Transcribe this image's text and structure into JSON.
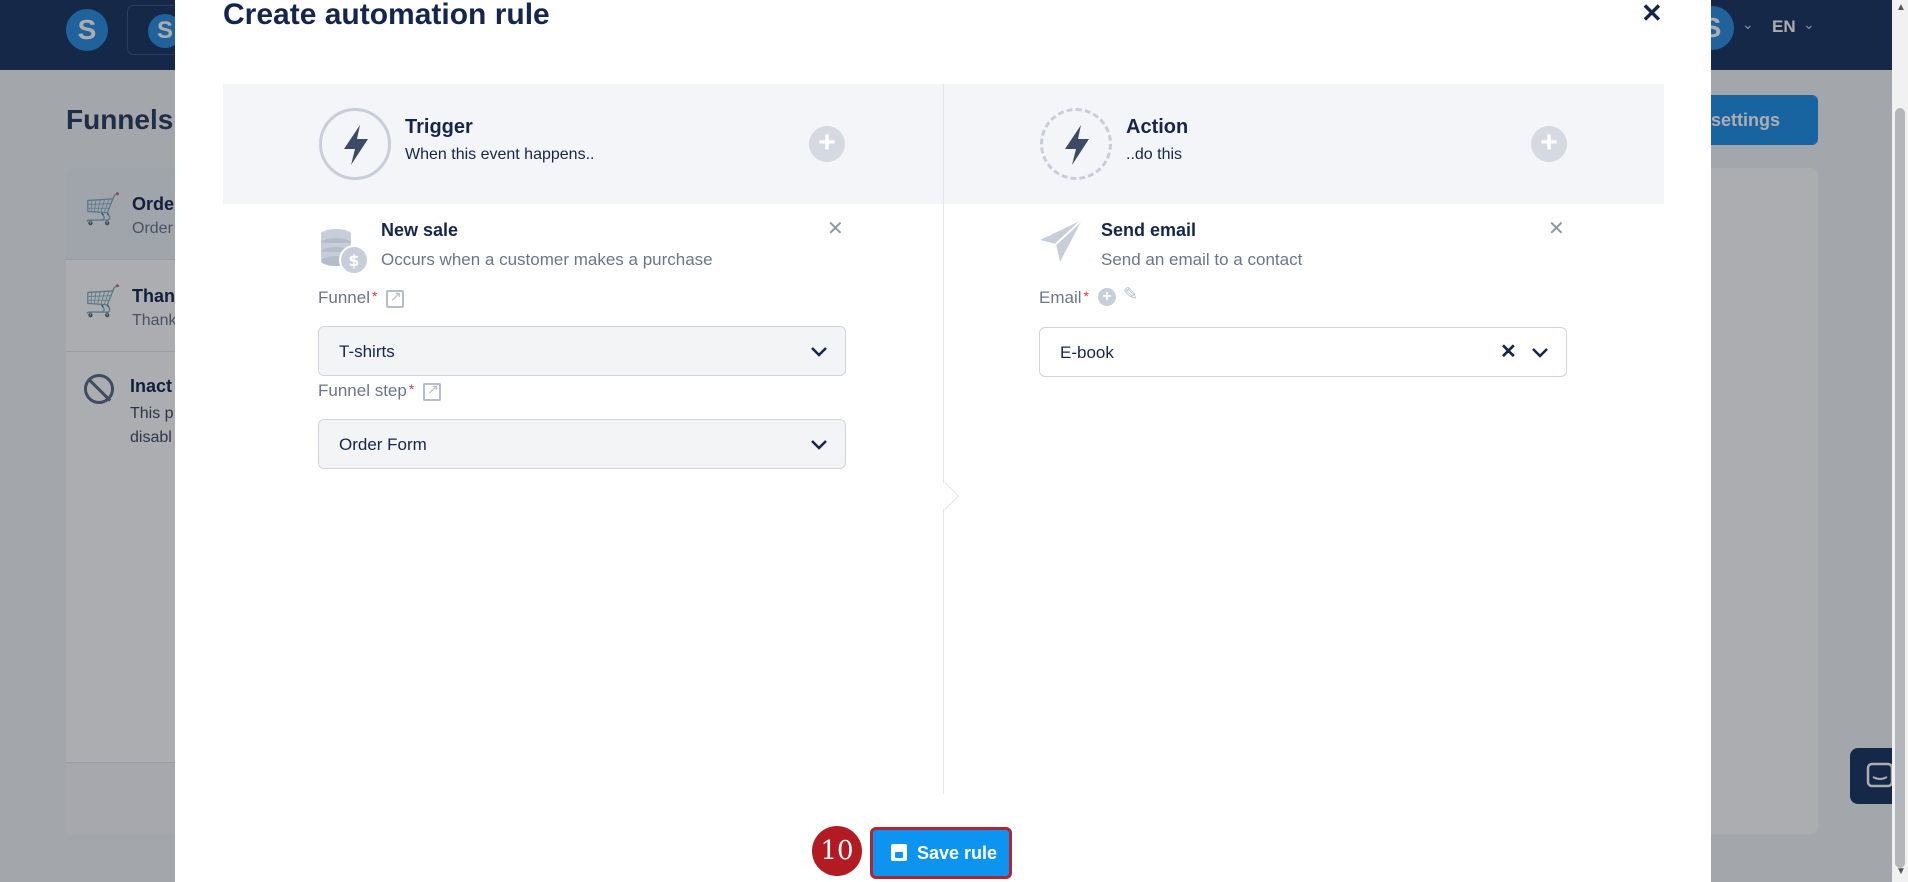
{
  "background": {
    "language": "EN",
    "page_title": "Funnels",
    "settings_button": "nel settings",
    "steps": [
      {
        "name": "Orde",
        "sub": "Order"
      },
      {
        "name": "Than",
        "sub": "Thank"
      }
    ],
    "inactive": {
      "title": "Inact",
      "text": "This p\ndisabl"
    }
  },
  "modal": {
    "title": "Create automation rule",
    "close_icon": "close-icon",
    "trigger": {
      "title": "Trigger",
      "subtitle": "When this event happens..",
      "card": {
        "title": "New sale",
        "subtitle": "Occurs when a customer makes a purchase"
      },
      "funnel_label": "Funnel",
      "funnel_value": "T-shirts",
      "step_label": "Funnel step",
      "step_value": "Order Form"
    },
    "action": {
      "title": "Action",
      "subtitle": "..do this",
      "card": {
        "title": "Send email",
        "subtitle": "Send an email to a contact"
      },
      "email_label": "Email",
      "email_value": "E-book"
    },
    "save_label": "Save rule",
    "step_badge": "10"
  },
  "colors": {
    "navy": "#1b3360",
    "primary": "#0d94f0",
    "highlight": "#b0262e",
    "required": "#e0354b"
  }
}
